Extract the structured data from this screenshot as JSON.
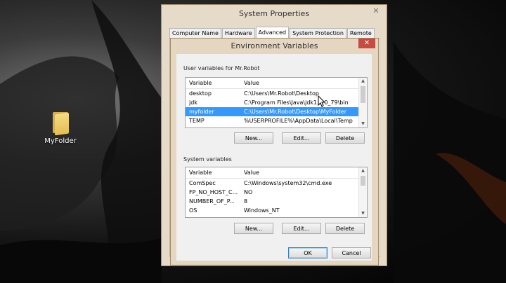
{
  "desktop": {
    "folder_label": "MyFolder"
  },
  "system_properties": {
    "title": "System Properties",
    "close": "✕",
    "tabs": [
      "Computer Name",
      "Hardware",
      "Advanced",
      "System Protection",
      "Remote"
    ],
    "active_tab": "Advanced"
  },
  "env_dialog": {
    "title": "Environment Variables",
    "close": "✕",
    "user_section_label": "User variables for Mr.Robot",
    "system_section_label": "System variables",
    "columns": {
      "variable": "Variable",
      "value": "Value"
    },
    "user_vars": [
      {
        "name": "desktop",
        "value": "C:\\Users\\Mr.Robot\\Desktop"
      },
      {
        "name": "jdk",
        "value": "C:\\Program Files\\Java\\jdk1.7.0_79\\bin"
      },
      {
        "name": "myfolder",
        "value": "C:\\Users\\Mr.Robot\\Desktop\\MyFolder"
      },
      {
        "name": "TEMP",
        "value": "%USERPROFILE%\\AppData\\Local\\Temp"
      }
    ],
    "user_selected": "myfolder",
    "system_vars": [
      {
        "name": "ComSpec",
        "value": "C:\\Windows\\system32\\cmd.exe"
      },
      {
        "name": "FP_NO_HOST_C...",
        "value": "NO"
      },
      {
        "name": "NUMBER_OF_P...",
        "value": "8"
      },
      {
        "name": "OS",
        "value": "Windows_NT"
      }
    ],
    "buttons": {
      "new": "New...",
      "edit": "Edit...",
      "delete": "Delete",
      "ok": "OK",
      "cancel": "Cancel"
    }
  },
  "colors": {
    "selection": "#3399ff",
    "close_red": "#c94a3e",
    "window_frame": "#e4d6c1"
  }
}
